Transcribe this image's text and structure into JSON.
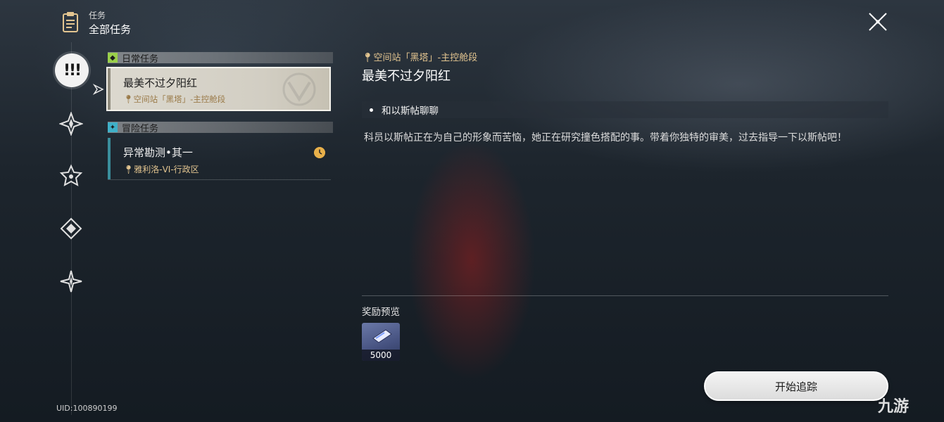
{
  "header": {
    "small_label": "任务",
    "title": "全部任务",
    "icon": "clipboard-icon"
  },
  "rail": {
    "active_icon": "exclamation-icon",
    "active_glyph": "!!!",
    "items": [
      "exclamation-icon",
      "diamond-star-icon",
      "star-icon",
      "diamond-icon",
      "diamond-sparkle-icon"
    ]
  },
  "uid": "UID:100890199",
  "categories": [
    {
      "label": "日常任务",
      "color": "#9ad04a",
      "quests": [
        {
          "name": "最美不过夕阳红",
          "location": "空间站「黑塔」-主控舱段",
          "selected": true
        }
      ]
    },
    {
      "label": "冒险任务",
      "color": "#3fb0c8",
      "quests": [
        {
          "name": "异常勘测•其一",
          "location": "雅利洛-VI-行政区",
          "selected": false,
          "timed": true
        }
      ]
    }
  ],
  "detail": {
    "location": "空间站「黑塔」-主控舱段",
    "title": "最美不过夕阳红",
    "objective": "和以斯帖聊聊",
    "description": "科员以斯帖正在为自己的形象而苦恼，她正在研究撞色搭配的事。带着你独特的审美，过去指导一下以斯帖吧！",
    "reward_title": "奖励预览",
    "rewards": [
      {
        "icon": "credit-chip-icon",
        "quantity": "5000"
      }
    ],
    "track_button": "开始追踪"
  },
  "watermark": "九游"
}
